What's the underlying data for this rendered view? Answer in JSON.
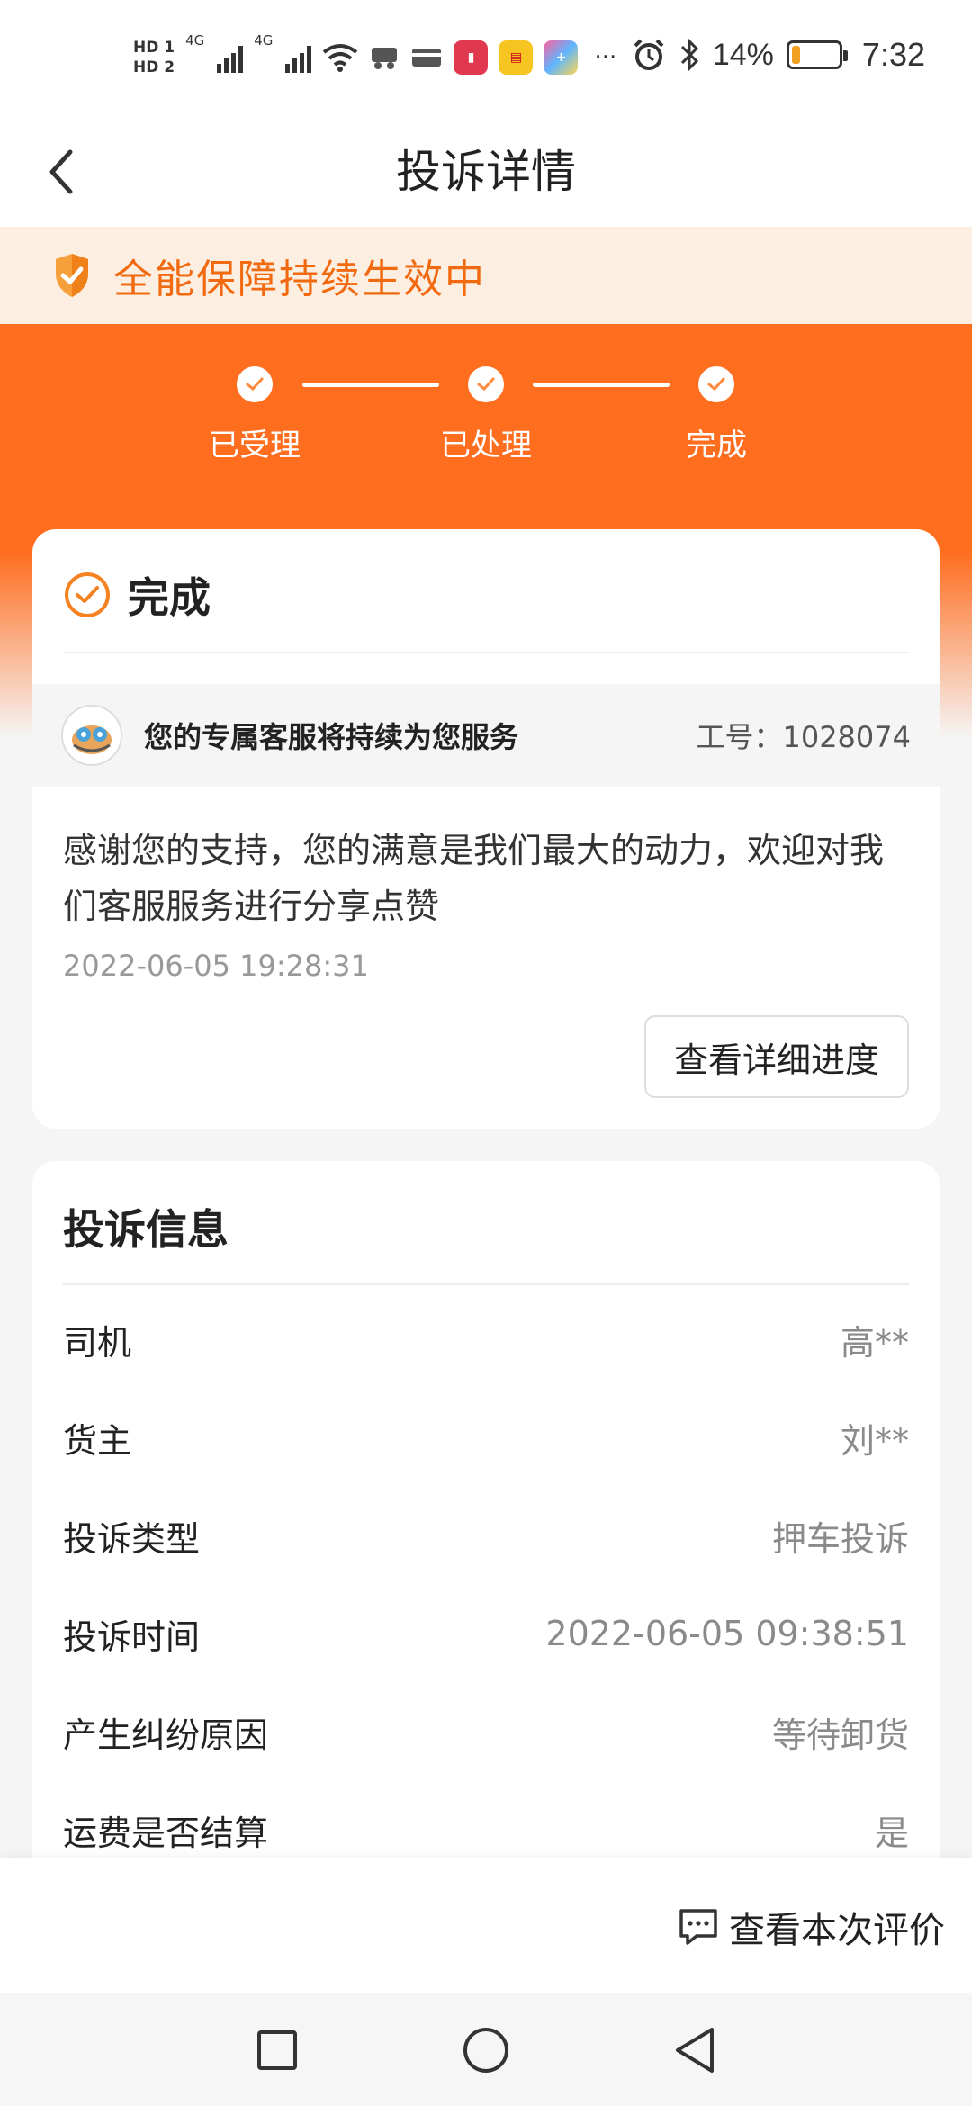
{
  "status_bar": {
    "hd1": "HD 1",
    "hd2": "HD 2",
    "network1": "4G",
    "network2": "4G",
    "more": "···",
    "battery_level": 0.14,
    "battery_text": "14%",
    "time": "7:32"
  },
  "header": {
    "title": "投诉详情"
  },
  "banner": {
    "text": "全能保障持续生效中"
  },
  "progress": {
    "steps": [
      {
        "label": "已受理"
      },
      {
        "label": "已处理"
      },
      {
        "label": "完成"
      }
    ]
  },
  "status_card": {
    "title": "完成",
    "agent_text": "您的专属客服将持续为您服务",
    "agent_id_label": "工号：1028074",
    "message": "感谢您的支持，您的满意是我们最大的动力，欢迎对我们客服服务进行分享点赞",
    "time": "2022-06-05 19:28:31",
    "detail_button": "查看详细进度"
  },
  "info_card": {
    "title": "投诉信息",
    "rows": [
      {
        "label": "司机",
        "value": "高**"
      },
      {
        "label": "货主",
        "value": "刘**"
      },
      {
        "label": "投诉类型",
        "value": "押车投诉"
      },
      {
        "label": "投诉时间",
        "value": "2022-06-05 09:38:51"
      },
      {
        "label": "产生纠纷原因",
        "value": "等待卸货"
      },
      {
        "label": "运费是否结算",
        "value": "是"
      }
    ]
  },
  "bottom_bar": {
    "evaluate_button": "查看本次评价"
  },
  "colors": {
    "brand": "#ff6d1f",
    "banner_bg": "#fdeee2",
    "banner_text": "#f26a10"
  }
}
